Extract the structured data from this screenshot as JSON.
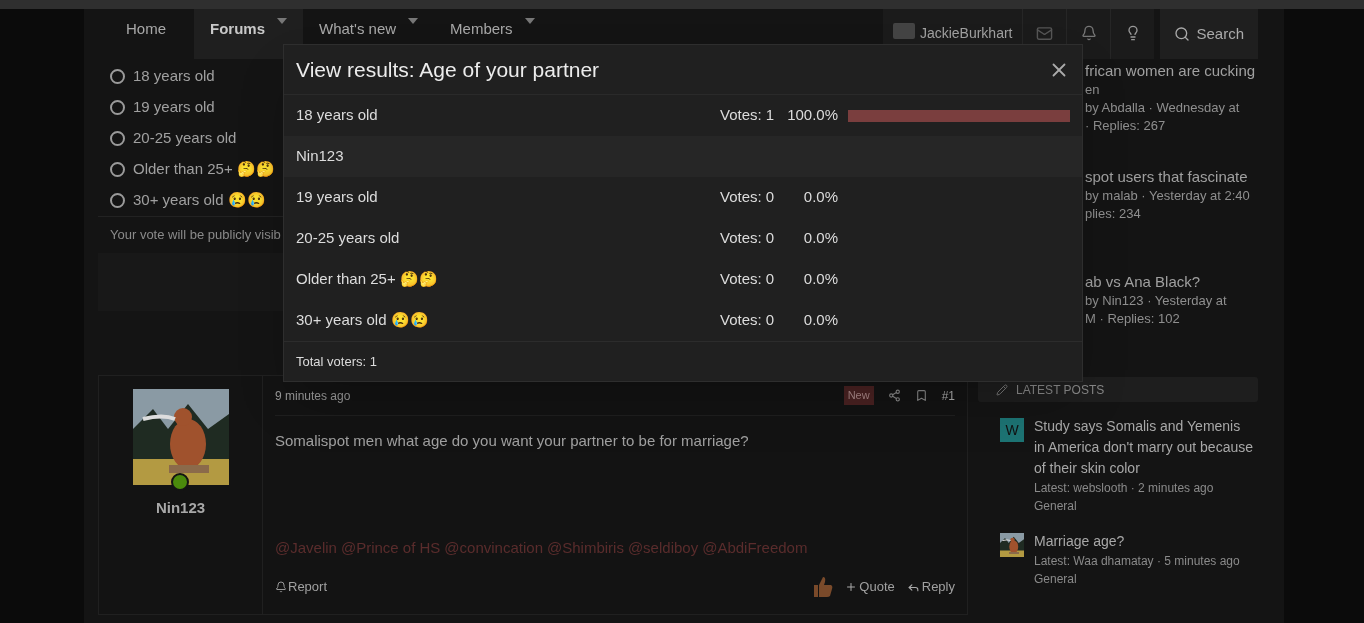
{
  "nav": {
    "tabs": [
      {
        "label": "Home",
        "selected": false,
        "has_menu": false
      },
      {
        "label": "Forums",
        "selected": true,
        "has_menu": true
      },
      {
        "label": "What's new",
        "selected": false,
        "has_menu": true
      },
      {
        "label": "Members",
        "selected": false,
        "has_menu": true
      }
    ],
    "user": "JackieBurkhart",
    "search": "Search"
  },
  "poll": {
    "options": [
      {
        "label": "18 years old",
        "selected": false
      },
      {
        "label": "19 years old",
        "selected": false
      },
      {
        "label": "20-25 years old",
        "selected": false
      },
      {
        "label": "Older than 25+ 🤔🤔",
        "selected": false
      },
      {
        "label": "30+ years old 😢😢",
        "selected": false
      }
    ],
    "note": "Your vote will be publicly visib"
  },
  "sidebar_threads": [
    {
      "lines": [
        "frican women are cucking",
        "en",
        "by Abdalla · Wednesday at",
        "· Replies: 267"
      ]
    },
    {
      "lines": [
        "spot users that fascinate",
        "by malab · Yesterday at 2:40",
        "plies: 234"
      ]
    },
    {
      "lines": [
        "ab vs Ana Black?",
        "by Nin123 · Yesterday at",
        "M · Replies: 102"
      ]
    }
  ],
  "latest_posts": {
    "title": "LATEST POSTS",
    "items": [
      {
        "kind": "letter",
        "avatar": "W",
        "color": "#1d7474",
        "title": "Study says Somalis and Yemenis in America don't marry out because of their skin color",
        "meta": "Latest: webslooth · 2 minutes ago",
        "forum": "General"
      },
      {
        "kind": "picture",
        "title": "Marriage age?",
        "meta": "Latest: Waa dhamatay · 5 minutes ago",
        "forum": "General"
      }
    ]
  },
  "post": {
    "author": "Nin123",
    "online": true,
    "time": "9 minutes ago",
    "badge": "New",
    "number": "#1",
    "message": "Somalispot men what age do you want your partner to be for marriage?",
    "mentions": [
      "@Javelin",
      "@Prince of HS",
      "@convincation",
      "@Shimbiris",
      "@seldiboy",
      "@AbdiFreedom"
    ],
    "report": "Report",
    "quote": "Quote",
    "reply": "Reply"
  },
  "results_dialog": {
    "title": "View results: Age of your partner",
    "options": [
      {
        "label": "18 years old",
        "votes": "Votes: 1",
        "percent": "100.0%",
        "level": 1.0,
        "voters": [
          "Nin123"
        ]
      },
      {
        "label": "19 years old",
        "votes": "Votes: 0",
        "percent": "0.0%"
      },
      {
        "label": "20-25 years old",
        "votes": "Votes: 0",
        "percent": "0.0%"
      },
      {
        "label": "Older than 25+ 🤔🤔",
        "votes": "Votes: 0",
        "percent": "0.0%"
      },
      {
        "label": "30+ years old 😢😢",
        "votes": "Votes: 0",
        "percent": "0.0%"
      }
    ],
    "total": "Total voters: 1"
  }
}
